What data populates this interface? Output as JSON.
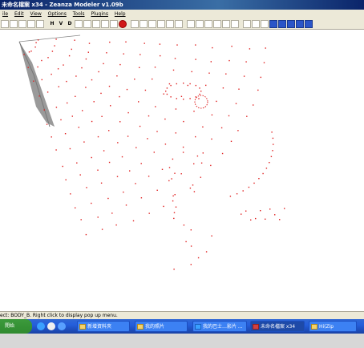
{
  "window": {
    "title": "未命名檔案 x34 - Zeanza Modeler v1.09b"
  },
  "menu": {
    "items": [
      "ile",
      "Edit",
      "View",
      "Options",
      "Tools",
      "Plugins",
      "Help"
    ]
  },
  "toolbar": {
    "letters": [
      "H",
      "V",
      "D"
    ]
  },
  "status": {
    "text": "ect: BODY_B. Right click to display pop up menu."
  },
  "taskbar": {
    "start_label": "開始",
    "tasks": [
      "新增資料夾",
      "我的照片",
      "我的巴士…影片 ...",
      "未命名檔案 x34",
      "Hi(Zip"
    ]
  },
  "colors": {
    "point": "#e02020",
    "titlebar": "#0a246a",
    "taskbar": "#245edb"
  }
}
